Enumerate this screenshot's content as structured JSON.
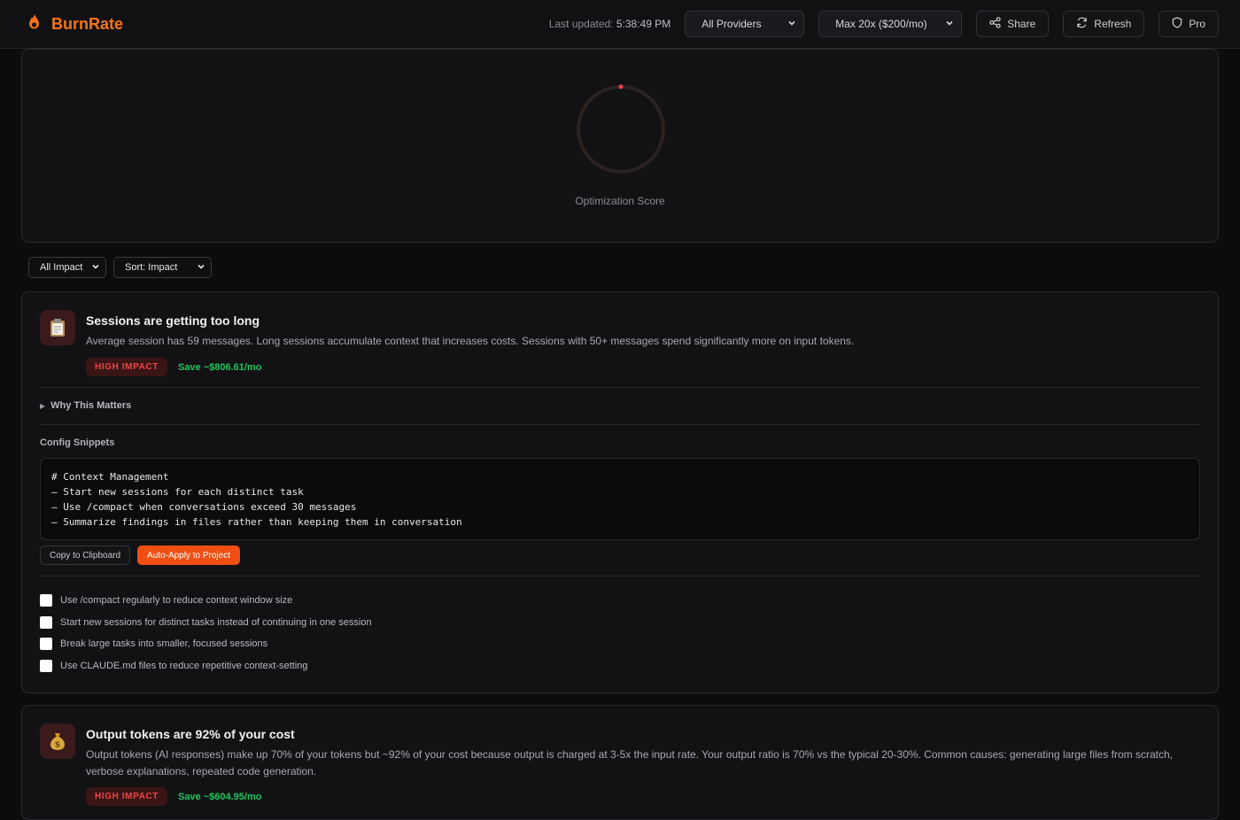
{
  "header": {
    "brand": "BurnRate",
    "last_updated_label": "Last updated:",
    "last_updated_time": "5:38:49 PM",
    "provider_select": "All Providers",
    "plan_select": "Max 20x ($200/mo)",
    "share_label": "Share",
    "refresh_label": "Refresh",
    "pro_label": "Pro",
    "accent_color": "#f97316"
  },
  "score": {
    "label": "Optimization Score"
  },
  "filters": {
    "impact": "All Impact",
    "sort": "Sort: Impact"
  },
  "cards": [
    {
      "icon": "clipboard-icon",
      "title": "Sessions are getting too long",
      "description": "Average session has 59 messages. Long sessions accumulate context that increases costs. Sessions with 50+ messages spend significantly more on input tokens.",
      "impact": "HIGH IMPACT",
      "savings": "Save ~$806.61/mo",
      "why_label": "Why This Matters",
      "snippets_label": "Config Snippets",
      "code_lines": [
        "# Context Management",
        "– Start new sessions for each distinct task",
        "– Use /compact when conversations exceed 30 messages",
        "– Summarize findings in files rather than keeping them in conversation"
      ],
      "copy_label": "Copy to Clipboard",
      "apply_label": "Auto-Apply to Project",
      "checklist": [
        "Use /compact regularly to reduce context window size",
        "Start new sessions for distinct tasks instead of continuing in one session",
        "Break large tasks into smaller, focused sessions",
        "Use CLAUDE.md files to reduce repetitive context-setting"
      ]
    },
    {
      "icon": "money-bag-icon",
      "title": "Output tokens are 92% of your cost",
      "description": "Output tokens (AI responses) make up 70% of your tokens but ~92% of your cost because output is charged at 3-5x the input rate. Your output ratio is 70% vs the typical 20-30%. Common causes: generating large files from scratch, verbose explanations, repeated code generation.",
      "impact": "HIGH IMPACT",
      "savings": "Save ~$604.95/mo"
    }
  ]
}
